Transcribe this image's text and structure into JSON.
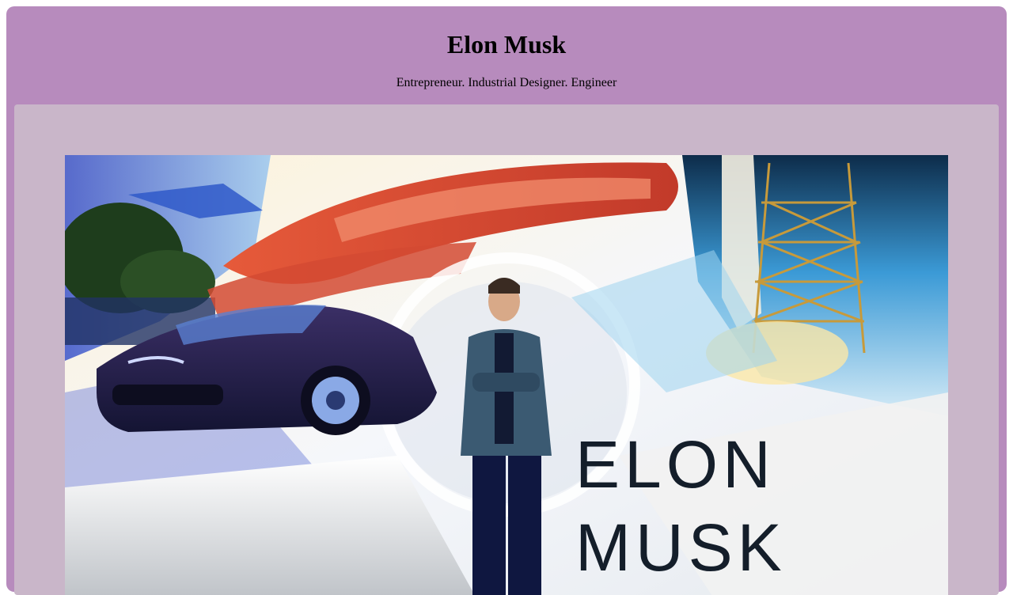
{
  "header": {
    "title": "Elon Musk",
    "subtitle": "Entrepreneur. Industrial Designer. Engineer"
  },
  "hero": {
    "description_alt": "Elon Musk",
    "overlay_text_line1": "ELON",
    "overlay_text_line2": "MUSK"
  },
  "colors": {
    "page_background": "#b78bbd",
    "panel_background": "#c9b6c9",
    "title_color": "#000000"
  }
}
